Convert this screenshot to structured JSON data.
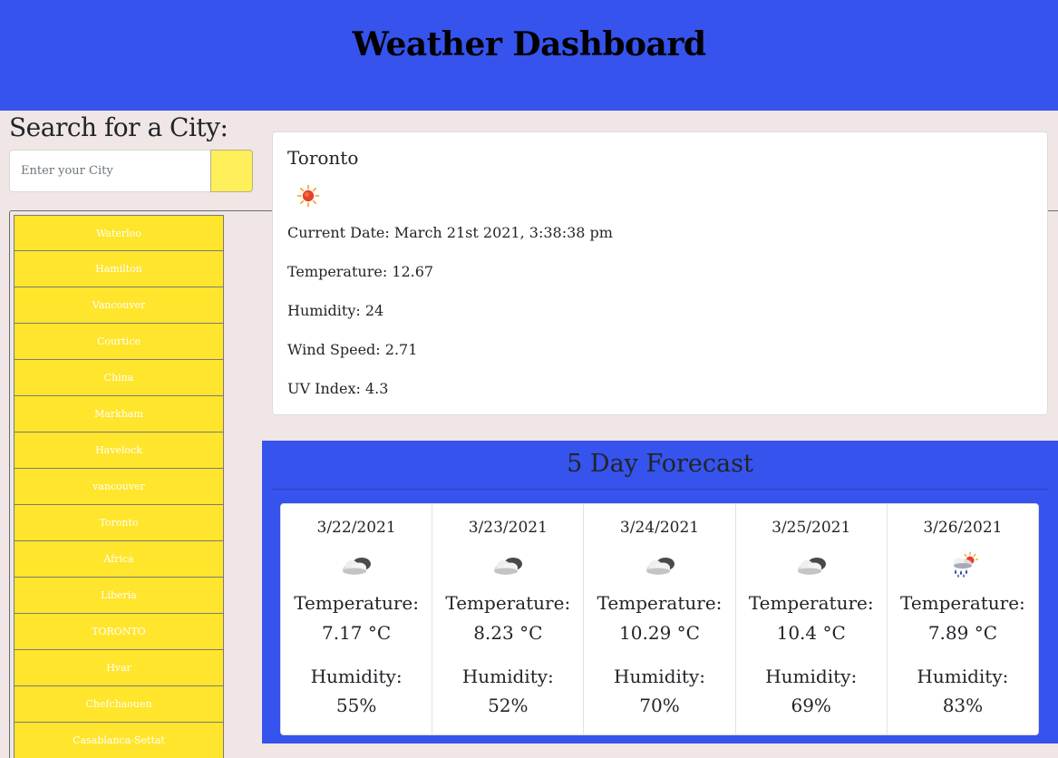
{
  "header": {
    "title": "Weather Dashboard"
  },
  "search": {
    "title": "Search for a City:",
    "placeholder": "Enter your City",
    "button_color": "#ffef5a"
  },
  "history": {
    "items": [
      "Waterloo",
      "Hamilton",
      "Vancouver",
      "Courtice",
      "China",
      "Markham",
      "Havelock",
      "vancouver",
      "Toronto",
      "Africa",
      "Liberia",
      "TORONTO",
      "Hvar",
      "Chefchaouen",
      "Casablanca-Settat"
    ],
    "item_color": "#ffe52b"
  },
  "current": {
    "city": "Toronto",
    "icon": "sunny-icon",
    "date": "Current Date: March 21st 2021, 3:38:38 pm",
    "temperature": "Temperature: 12.67",
    "humidity": "Humidity: 24",
    "wind": "Wind Speed: 2.71",
    "uv": "UV Index: 4.3"
  },
  "forecast": {
    "title": "5 Day Forecast",
    "panel_color": "#3653ed",
    "temp_label": "Temperature:",
    "humidity_label": "Humidity:",
    "days": [
      {
        "date": "3/22/2021",
        "icon": "cloudy-icon",
        "temp": "7.17 °C",
        "humidity": "55%"
      },
      {
        "date": "3/23/2021",
        "icon": "cloudy-icon",
        "temp": "8.23 °C",
        "humidity": "52%"
      },
      {
        "date": "3/24/2021",
        "icon": "cloudy-icon",
        "temp": "10.29 °C",
        "humidity": "70%"
      },
      {
        "date": "3/25/2021",
        "icon": "cloudy-icon",
        "temp": "10.4 °C",
        "humidity": "69%"
      },
      {
        "date": "3/26/2021",
        "icon": "rain-sun-icon",
        "temp": "7.89 °C",
        "humidity": "83%"
      }
    ]
  }
}
